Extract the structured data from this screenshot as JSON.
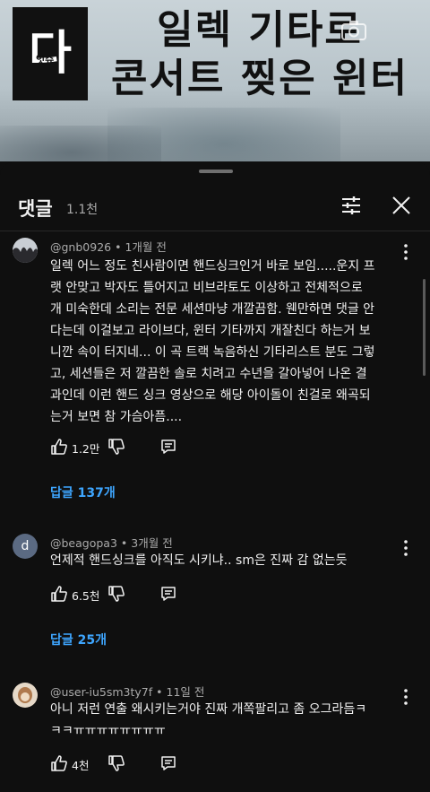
{
  "video": {
    "logo_text": "다",
    "logo_sub": "잇슈",
    "title_line1": "일렉 기타로",
    "title_line2": "콘서트 찢은 윈터"
  },
  "comments_panel": {
    "title": "댓글",
    "count": "1.1천",
    "icons": {
      "filter": "filter-sliders-icon",
      "close": "close-icon"
    }
  },
  "comments": [
    {
      "author": "@gnb0926",
      "time": "1개월 전",
      "text_lines": [
        "일렉 어느 정도 친사람이면 핸드싱크인거 바로 보임.....운지 프",
        "랫 안맞고 박자도 틀어지고 비브라토도 이상하고 전체적으로",
        "개 미숙한데 소리는 전문 세션마냥 개깔끔함. 웬만하면 댓글 안",
        "다는데 이걸보고 라이브다, 윈터 기타까지 개잘친다 하는거 보",
        "니깐 속이 터지네... 이 곡 트랙 녹음하신 기타리스트 분도 그렇",
        "고, 세션들은 저 깔끔한 솔로 치려고 수년을 갈아넣어 나온 결",
        "과인데 이런 핸드 싱크 영상으로 해당 아이돌이 친걸로 왜곡되",
        "는거 보면 참 가슴아픔...."
      ],
      "likes": "1.2만",
      "replies": "답글 137개"
    },
    {
      "author": "@beagopa3",
      "time": "3개월 전",
      "avatar_letter": "d",
      "text_lines": [
        "언제적 핸드싱크를 아직도 시키냐.. sm은 진짜 감 없는듯"
      ],
      "likes": "6.5천",
      "replies": "답글 25개"
    },
    {
      "author": "@user-iu5sm3ty7f",
      "time": "11일 전",
      "text_lines": [
        "아니 저런 연출 왜시키는거야 진짜 개쪽팔리고 좀 오그라듬ㅋ",
        "ㅋㅋㅠㅠㅠㅠㅠㅠㅠㅠ"
      ],
      "likes": "4천"
    }
  ],
  "separator": "•",
  "colors": {
    "background": "#0f0f0f",
    "link": "#3ea6ff",
    "secondary_text": "#aaaaaa"
  }
}
